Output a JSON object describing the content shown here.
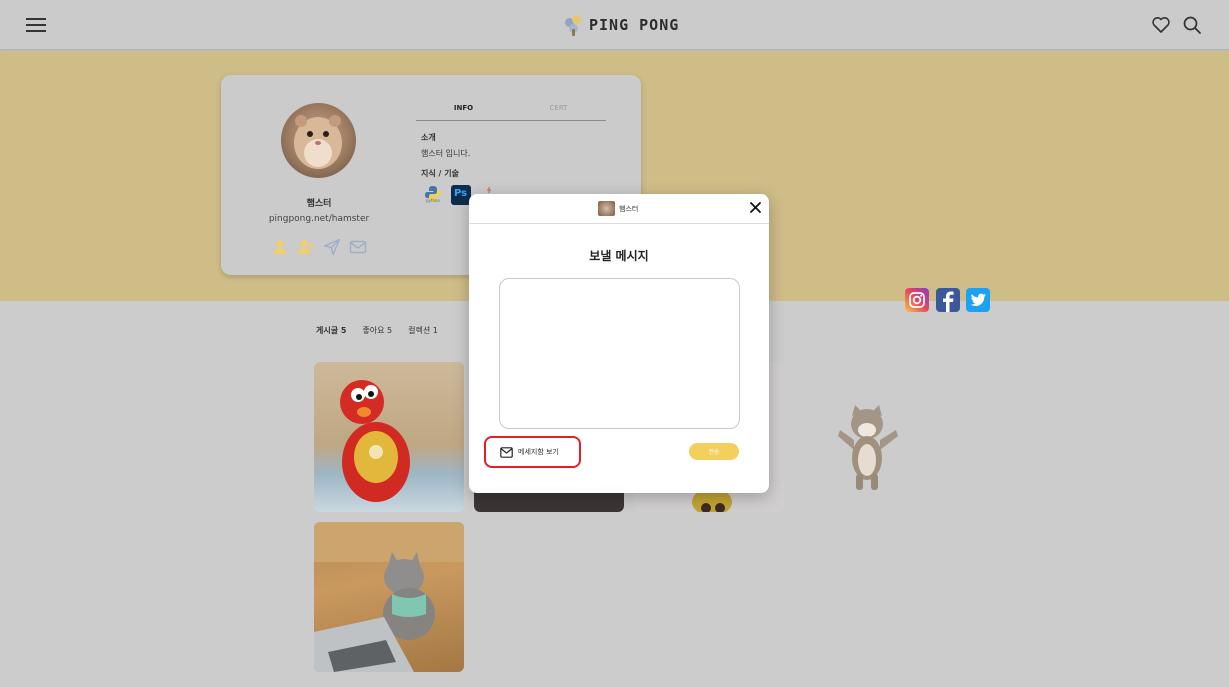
{
  "header": {
    "logo_text": "PING PONG",
    "icons": [
      "menu-icon",
      "heart-icon",
      "search-icon"
    ]
  },
  "profile": {
    "name": "햄스터",
    "url": "pingpong.net/hamster",
    "tabs": [
      {
        "label": "INFO",
        "active": true
      },
      {
        "label": "CERT",
        "active": false
      }
    ],
    "intro_heading": "소개",
    "intro_text": "햄스터 입니다.",
    "skills_heading": "지식 / 기술",
    "skill_icons": [
      "python-icon",
      "photoshop-icon",
      "other-skill-icon"
    ],
    "skill_python_label": "python",
    "skill_photoshop_label": "Ps",
    "action_icons": [
      "person-icon",
      "add-person-icon",
      "send-icon",
      "mail-icon"
    ]
  },
  "social_icons": [
    "instagram-icon",
    "facebook-icon",
    "twitter-icon"
  ],
  "post_tabs": [
    {
      "label": "게시글 5",
      "active": true
    },
    {
      "label": "좋아요 5",
      "active": false
    },
    {
      "label": "컬렉션 1",
      "active": false
    }
  ],
  "modal": {
    "user": "햄스터",
    "title": "보낼 메시지",
    "textarea_value": "",
    "view_messages_label": "메세지함 보기",
    "send_label": "전송"
  },
  "colors": {
    "banner": "#cfbd88",
    "background": "#cccccc",
    "accent_yellow": "#f3cf5e",
    "highlight_red": "#e01f26"
  }
}
